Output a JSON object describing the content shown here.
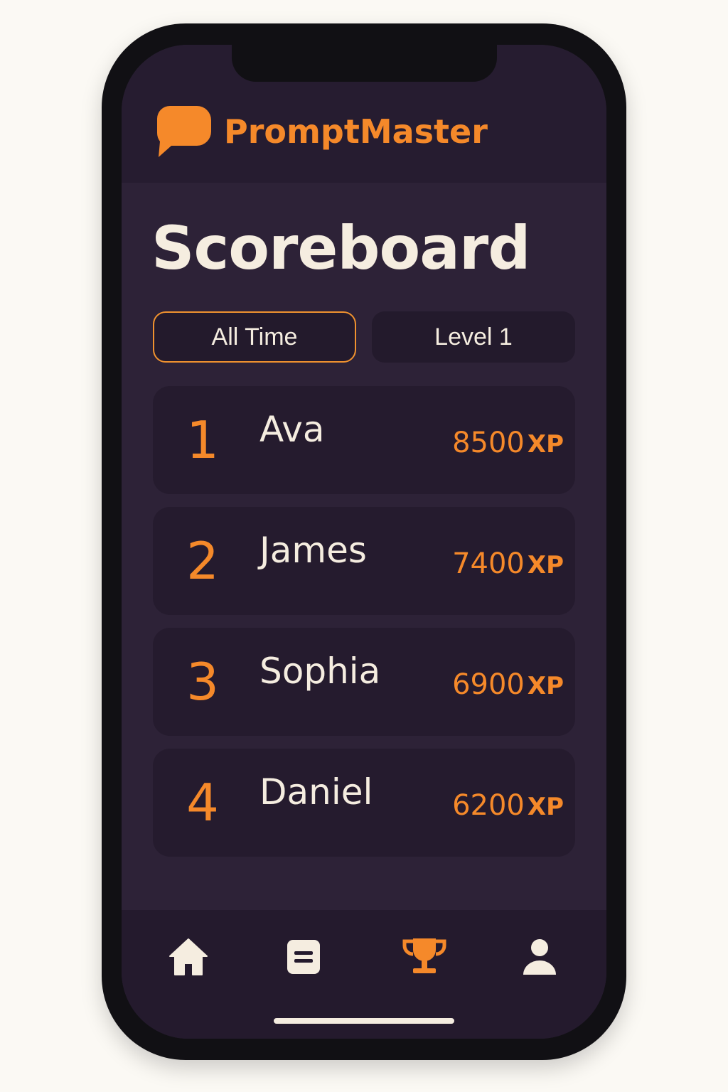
{
  "app": {
    "name": "PromptMaster",
    "logo_icon": "speech-bubble-icon",
    "brand_color": "#f5892a"
  },
  "page": {
    "title": "Scoreboard"
  },
  "tabs": [
    {
      "label": "All Time",
      "selected": true
    },
    {
      "label": "Level 1",
      "selected": false
    }
  ],
  "leaderboard": [
    {
      "rank": "1",
      "name": "Ava",
      "score": "8500",
      "unit": "XP"
    },
    {
      "rank": "2",
      "name": "James",
      "score": "7400",
      "unit": "XP"
    },
    {
      "rank": "3",
      "name": "Sophia",
      "score": "6900",
      "unit": "XP"
    },
    {
      "rank": "4",
      "name": "Daniel",
      "score": "6200",
      "unit": "XP"
    }
  ],
  "bottom_nav": [
    {
      "icon": "home-icon",
      "active": false
    },
    {
      "icon": "document-icon",
      "active": false
    },
    {
      "icon": "trophy-icon",
      "active": true
    },
    {
      "icon": "profile-icon",
      "active": false
    }
  ],
  "colors": {
    "background": "#2d2237",
    "card": "#251b2e",
    "text": "#f5ede0",
    "accent": "#f5892a"
  }
}
